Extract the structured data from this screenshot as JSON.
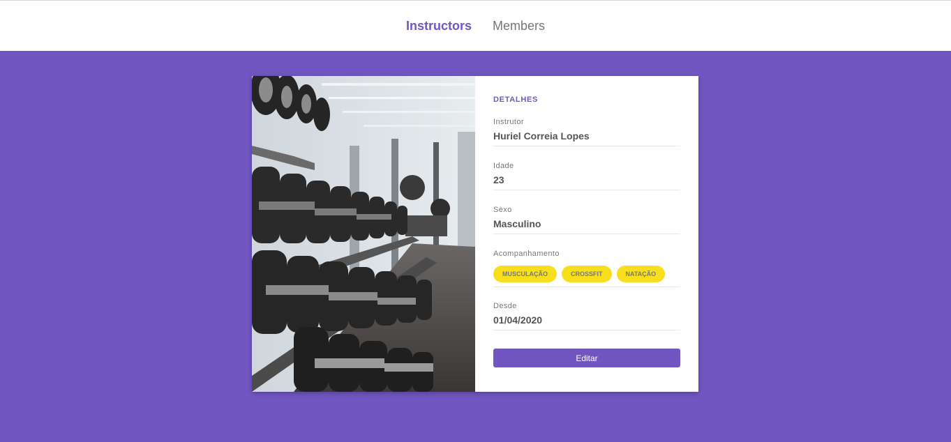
{
  "nav": {
    "items": [
      {
        "label": "Instructors",
        "active": true
      },
      {
        "label": "Members",
        "active": false
      }
    ]
  },
  "details": {
    "section_title": "DETALHES",
    "instructor": {
      "label": "Instrutor",
      "value": "Huriel Correia Lopes"
    },
    "age": {
      "label": "Idade",
      "value": "23"
    },
    "gender": {
      "label": "Sexo",
      "value": "Masculino"
    },
    "services": {
      "label": "Acompanhamento",
      "tags": [
        "MUSCULAÇÃO",
        "CROSSFIT",
        "NATAÇÃO"
      ]
    },
    "since": {
      "label": "Desde",
      "value": "01/04/2020"
    },
    "edit_label": "Editar"
  },
  "colors": {
    "primary": "#7156c1",
    "tag": "#f7df1e"
  },
  "image": {
    "subject": "gym-dumbbell-rack-photo"
  }
}
